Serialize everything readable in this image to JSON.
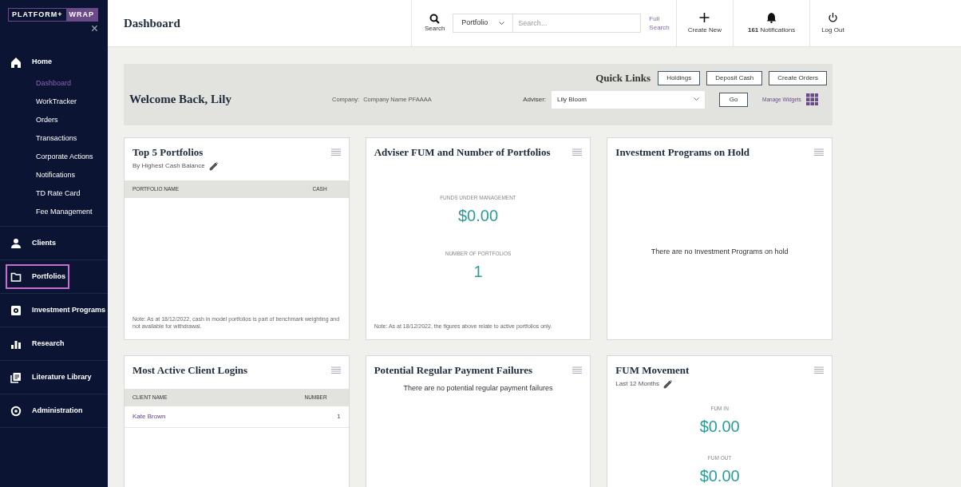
{
  "sidebar": {
    "logo": {
      "left": "PLATFORM+",
      "right": "WRAP"
    },
    "close": "×",
    "items": [
      {
        "label": "Home",
        "highlighted": false,
        "children": [
          {
            "label": "Dashboard",
            "selected": true
          },
          {
            "label": "WorkTracker",
            "selected": false
          },
          {
            "label": "Orders",
            "selected": false
          },
          {
            "label": "Transactions",
            "selected": false
          },
          {
            "label": "Corporate Actions",
            "selected": false
          },
          {
            "label": "Notifications",
            "selected": false
          },
          {
            "label": "TD Rate Card",
            "selected": false
          },
          {
            "label": "Fee Management",
            "selected": false
          }
        ]
      },
      {
        "label": "Clients",
        "highlighted": false
      },
      {
        "label": "Portfolios",
        "highlighted": true
      },
      {
        "label": "Investment Programs",
        "highlighted": false
      },
      {
        "label": "Research",
        "highlighted": false
      },
      {
        "label": "Literature Library",
        "highlighted": false
      },
      {
        "label": "Administration",
        "highlighted": false
      }
    ]
  },
  "header": {
    "title": "Dashboard",
    "search_label": "Search",
    "search_scope": "Portfolio",
    "search_placeholder": "Search...",
    "full_search": [
      "Full",
      "Search"
    ],
    "create_new": "Create New",
    "notifications_count": "161",
    "notifications_label": "Notifications",
    "log_out": "Log Out"
  },
  "welcome": {
    "greeting": "Welcome Back, Lily",
    "quick_links_title": "Quick Links",
    "quick_links": [
      "Holdings",
      "Deposit Cash",
      "Create Orders"
    ],
    "company_label": "Company:",
    "company": "Company Name PFAAAA",
    "adviser_label": "Adviser:",
    "adviser": "Lily Bloom",
    "go": "Go",
    "manage_widgets": "Manage Widgets"
  },
  "widgets": [
    {
      "kind": "table",
      "title": "Top 5 Portfolios",
      "subtitle": "By Highest Cash Balance",
      "columns": [
        "PORTFOLIO NAME",
        "CASH"
      ],
      "note": "Note: As at 18/12/2022, cash in model portfolios is part of benchmark weighting and not available for withdrawal."
    },
    {
      "kind": "stats",
      "title": "Adviser FUM and Number of Portfolios",
      "stats": [
        {
          "label": "FUNDS UNDER MANAGEMENT",
          "value": "$0.00"
        },
        {
          "label": "NUMBER OF PORTFOLIOS",
          "value": "1"
        }
      ],
      "note": "Note: As at 18/12/2022, the figures above relate to active portfolios only."
    },
    {
      "kind": "empty",
      "title": "Investment Programs on Hold",
      "message": "There are no Investment Programs on hold"
    },
    {
      "kind": "table",
      "title": "Most Active Client Logins",
      "columns": [
        "CLIENT NAME",
        "NUMBER"
      ],
      "rows": [
        [
          "Kate Brown",
          "1"
        ]
      ]
    },
    {
      "kind": "notice",
      "title": "Potential Regular Payment Failures",
      "message": "There are no potential regular payment failures"
    },
    {
      "kind": "stats",
      "title": "FUM Movement",
      "subtitle": "Last 12 Months",
      "stats": [
        {
          "label": "FUM IN",
          "value": "$0.00"
        },
        {
          "label": "FUM OUT",
          "value": "$0.00"
        }
      ]
    }
  ]
}
